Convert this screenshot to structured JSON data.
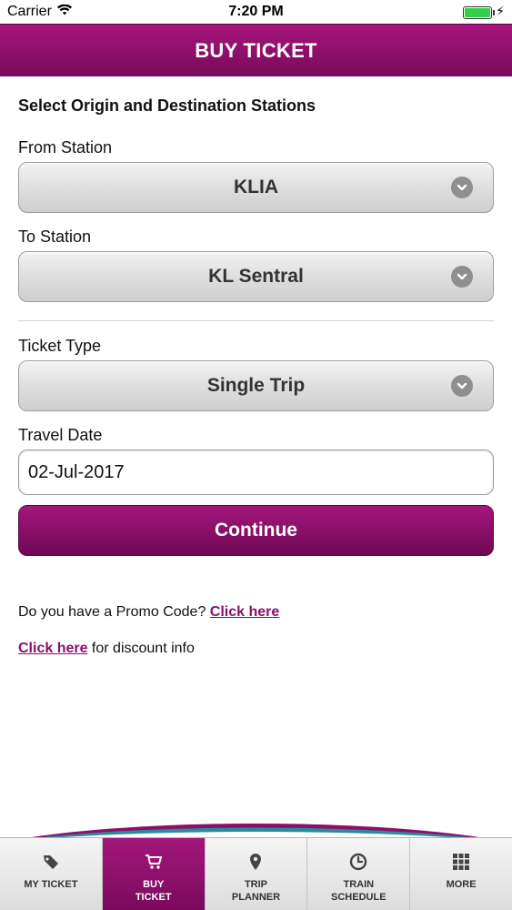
{
  "status_bar": {
    "carrier": "Carrier",
    "time": "7:20 PM"
  },
  "header": {
    "title": "BUY TICKET"
  },
  "form": {
    "section_title": "Select Origin and Destination Stations",
    "from_label": "From Station",
    "from_value": "KLIA",
    "to_label": "To Station",
    "to_value": "KL Sentral",
    "ticket_type_label": "Ticket Type",
    "ticket_type_value": "Single Trip",
    "travel_date_label": "Travel Date",
    "travel_date_value": "02-Jul-2017",
    "continue_label": "Continue"
  },
  "links": {
    "promo_text": "Do you have a Promo Code? ",
    "promo_link": "Click here",
    "discount_link": "Click here",
    "discount_text": " for discount info"
  },
  "tabbar": {
    "tabs": [
      {
        "label": "MY TICKET",
        "icon": "tag-icon"
      },
      {
        "label": "BUY\nTICKET",
        "icon": "cart-icon"
      },
      {
        "label": "TRIP\nPLANNER",
        "icon": "map-pin-icon"
      },
      {
        "label": "TRAIN\nSCHEDULE",
        "icon": "clock-icon"
      },
      {
        "label": "MORE",
        "icon": "grid-icon"
      }
    ],
    "active_index": 1
  },
  "colors": {
    "brand": "#8c0f6a",
    "battery": "#33d14a"
  }
}
